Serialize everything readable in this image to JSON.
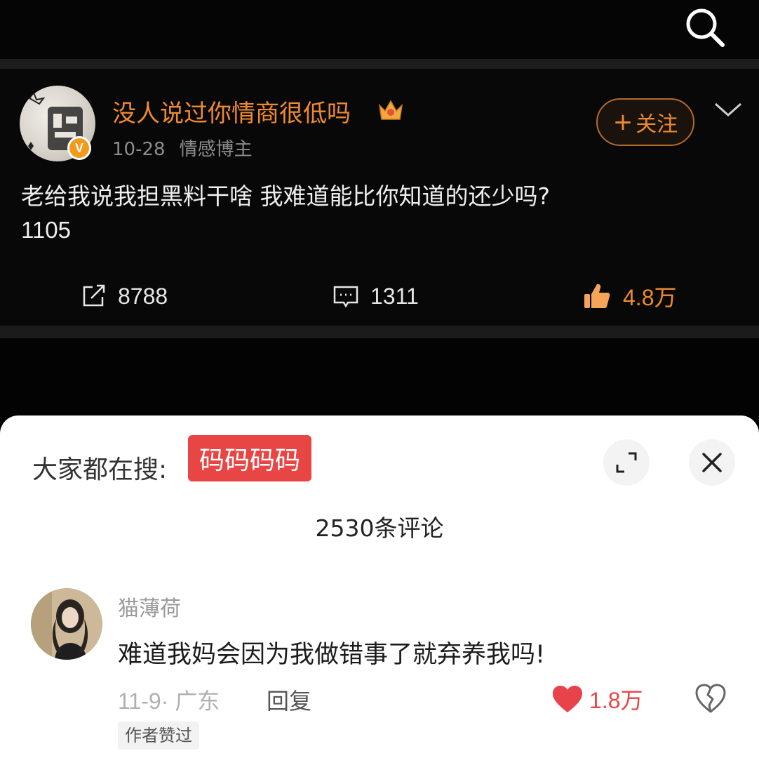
{
  "post": {
    "author_name": "没人说过你情商很低吗",
    "date": "10-28",
    "author_role": "情感博主",
    "follow_label": "关注",
    "text_line1": "老给我说我担黑料干啥 我难道能比你知道的还少吗?",
    "text_line2": "1105",
    "reposts": "8788",
    "comments": "1311",
    "likes": "4.8万"
  },
  "sheet": {
    "hot_search_label": "大家都在搜:",
    "hot_search_tag": "码码码码",
    "comment_count": "2530条评论"
  },
  "comment": {
    "user": "猫薄荷",
    "text": "难道我妈会因为我做错事了就弃养我吗!",
    "meta": "11-9· 广东",
    "reply_label": "回复",
    "likes": "1.8万",
    "author_badge": "作者赞过"
  },
  "colors": {
    "accent_orange": "#f08a30",
    "tag_red": "#e84545",
    "like_red": "#e84545"
  },
  "icons": [
    "search-icon",
    "crown-icon",
    "chevron-down-icon",
    "repost-icon",
    "comment-icon",
    "thumbs-up-icon",
    "expand-icon",
    "close-icon",
    "heart-icon",
    "broken-heart-icon",
    "verified-badge-icon"
  ]
}
